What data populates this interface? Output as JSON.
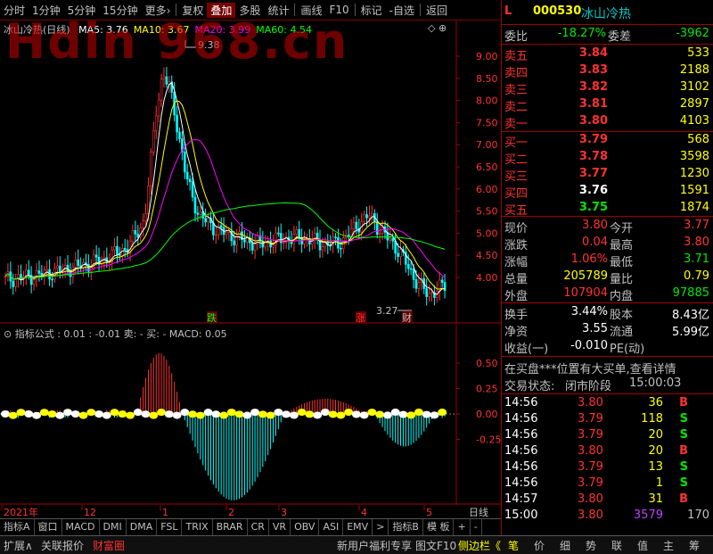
{
  "toolbar": {
    "items": [
      "分时",
      "1分钟",
      "5分钟",
      "15分钟",
      "更多›",
      "复权",
      "叠加",
      "多股",
      "统计",
      "画线",
      "F10",
      "标记",
      "-自选",
      "返回"
    ],
    "active_index": 6
  },
  "watermark": "Hdin 968.cn",
  "kline": {
    "title": "冰山冷热(日线)",
    "ma": [
      {
        "label": "MA5: 3.76",
        "color": "#ffffff"
      },
      {
        "label": "MA10: 3.67",
        "color": "#ffff00"
      },
      {
        "label": "MA20: 3.99",
        "color": "#ff00ff"
      },
      {
        "label": "MA60: 4.54",
        "color": "#00ff00"
      }
    ],
    "high_label": "9.38",
    "low_label": "3.27",
    "price_ticks": [
      "9.00",
      "8.50",
      "8.00",
      "7.50",
      "7.00",
      "6.50",
      "6.00",
      "5.50",
      "5.00",
      "4.50",
      "4.00"
    ],
    "markers": [
      {
        "text": "跌",
        "color": "#00ff00"
      },
      {
        "text": "涨",
        "color": "#ff3232"
      },
      {
        "text": "财",
        "color": "#c0c0c0"
      }
    ]
  },
  "macd": {
    "header": "指标公式 : 0.01  : -0.01  卖: -  买: -  MACD: 0.05",
    "ticks": [
      "0.50",
      "0.25",
      "0.00",
      "-0.25"
    ]
  },
  "time_axis": {
    "labels": [
      "2021年",
      "12",
      "1",
      "2",
      "3",
      "4",
      "5"
    ],
    "right_label": "日线"
  },
  "tabs": [
    "指标A",
    "窗口",
    "MACD",
    "DMI",
    "DMA",
    "FSL",
    "TRIX",
    "BRAR",
    "CR",
    "VR",
    "OBV",
    "ASI",
    "EMV",
    ">",
    "指标B",
    "模 板",
    "+",
    "-"
  ],
  "stock": {
    "flag": "L",
    "code": "000530",
    "name": "冰山冷热",
    "weibi_label": "委比",
    "weibi": "-18.27%",
    "weicha_label": "委差",
    "weicha": "-3962"
  },
  "sell_orders": [
    {
      "label": "卖五",
      "price": "3.84",
      "vol": "533"
    },
    {
      "label": "卖四",
      "price": "3.83",
      "vol": "2188"
    },
    {
      "label": "卖三",
      "price": "3.82",
      "vol": "3102"
    },
    {
      "label": "卖二",
      "price": "3.81",
      "vol": "2897"
    },
    {
      "label": "卖一",
      "price": "3.80",
      "vol": "4103"
    }
  ],
  "buy_orders": [
    {
      "label": "买一",
      "price": "3.79",
      "vol": "568"
    },
    {
      "label": "买二",
      "price": "3.78",
      "vol": "3598"
    },
    {
      "label": "买三",
      "price": "3.77",
      "vol": "1230"
    },
    {
      "label": "买四",
      "price": "3.76",
      "vol": "1591"
    },
    {
      "label": "买五",
      "price": "3.75",
      "vol": "1874"
    }
  ],
  "quote": [
    {
      "l1": "现价",
      "v1": "3.80",
      "l2": "今开",
      "v2": "3.77"
    },
    {
      "l1": "涨跌",
      "v1": "0.04",
      "l2": "最高",
      "v2": "3.80"
    },
    {
      "l1": "涨幅",
      "v1": "1.06%",
      "l2": "最低",
      "v2": "3.71"
    },
    {
      "l1": "总量",
      "v1": "205789",
      "l2": "量比",
      "v2": "0.79"
    },
    {
      "l1": "外盘",
      "v1": "107904",
      "l2": "内盘",
      "v2": "97885"
    }
  ],
  "fin": [
    {
      "l1": "换手",
      "v1": "3.44%",
      "l2": "股本",
      "v2": "8.43亿"
    },
    {
      "l1": "净资",
      "v1": "3.55",
      "l2": "流通",
      "v2": "5.99亿"
    },
    {
      "l1": "收益(一)",
      "v1": "-0.010",
      "l2": "PE(动)",
      "v2": ""
    }
  ],
  "news": "在买盘***位置有大买单,查看详情",
  "trade_status_label": "交易状态:",
  "trade_status": "闭市阶段",
  "trade_status_time": "15:00:03",
  "ticks": [
    {
      "t": "14:56",
      "p": "3.80",
      "v": "36",
      "bs": "B"
    },
    {
      "t": "14:56",
      "p": "3.79",
      "v": "118",
      "bs": "S"
    },
    {
      "t": "14:56",
      "p": "3.79",
      "v": "20",
      "bs": "S"
    },
    {
      "t": "14:56",
      "p": "3.80",
      "v": "20",
      "bs": "B"
    },
    {
      "t": "14:56",
      "p": "3.79",
      "v": "13",
      "bs": "S"
    },
    {
      "t": "14:56",
      "p": "3.79",
      "v": "1",
      "bs": "S"
    },
    {
      "t": "14:57",
      "p": "3.80",
      "v": "31",
      "bs": "B"
    },
    {
      "t": "15:00",
      "p": "3.80",
      "v": "3579",
      "bs": "170"
    }
  ],
  "status_left": [
    "扩展∧",
    "关联报价",
    "财富圈"
  ],
  "status_mid": [
    "新用户福利专享",
    "图文F10",
    "侧边栏《"
  ],
  "status_right": [
    "笔",
    "价",
    "细",
    "势",
    "联",
    "值",
    "主",
    "筹"
  ]
}
